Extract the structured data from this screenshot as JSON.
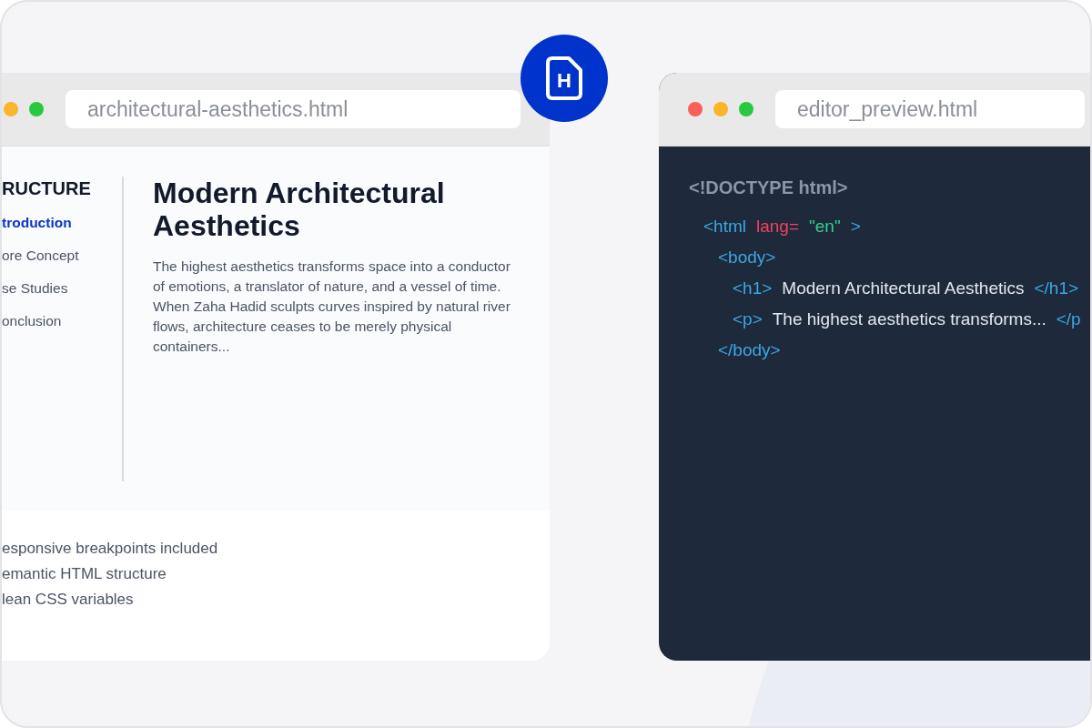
{
  "badge": {
    "letter": "H"
  },
  "preview_window": {
    "controls": [
      {
        "kind": "minimize"
      },
      {
        "kind": "maximize"
      }
    ],
    "address": "architectural-aesthetics.html",
    "nav": {
      "heading": "RUCTURE",
      "items": [
        {
          "label": "troduction",
          "selected": true
        },
        {
          "label": "ore Concept",
          "selected": false
        },
        {
          "label": "se Studies",
          "selected": false
        },
        {
          "label": "onclusion",
          "selected": false
        }
      ]
    },
    "article": {
      "title": "Modern Architectural Aesthetics",
      "body": "The highest aesthetics transforms space into a conductor of emotions, a translator of nature, and a vessel of time. When Zaha Hadid sculpts curves inspired by natural river flows, architecture ceases to be merely physical containers..."
    },
    "features": [
      "esponsive breakpoints included",
      "emantic HTML structure",
      "lean CSS variables"
    ]
  },
  "editor_window": {
    "controls": [
      {
        "kind": "close"
      },
      {
        "kind": "minimize"
      },
      {
        "kind": "maximize"
      }
    ],
    "address": "editor_preview.html",
    "code": [
      {
        "tokens": [
          {
            "kind": "doctype",
            "text": "<!DOCTYPE html>"
          }
        ],
        "children": [
          {
            "tokens": [
              {
                "kind": "tag",
                "text": "<html"
              },
              {
                "kind": "attr",
                "text": "lang="
              },
              {
                "kind": "string",
                "text": "\"en\""
              },
              {
                "kind": "tag",
                "text": ">"
              }
            ],
            "children": [
              {
                "tokens": [
                  {
                    "kind": "tag",
                    "text": "<body>"
                  }
                ],
                "children": [
                  {
                    "tokens": [
                      {
                        "kind": "tag",
                        "text": "<h1>"
                      },
                      {
                        "kind": "text",
                        "text": "Modern Architectural Aesthetics"
                      },
                      {
                        "kind": "tag",
                        "text": "</h1>"
                      }
                    ]
                  },
                  {
                    "tokens": [
                      {
                        "kind": "tag",
                        "text": "<p>"
                      },
                      {
                        "kind": "text",
                        "text": "The highest aesthetics transforms..."
                      },
                      {
                        "kind": "tag",
                        "text": "</p"
                      }
                    ]
                  }
                ]
              },
              {
                "tokens": [
                  {
                    "kind": "tag",
                    "text": "</body>"
                  }
                ]
              }
            ]
          }
        ]
      }
    ]
  }
}
